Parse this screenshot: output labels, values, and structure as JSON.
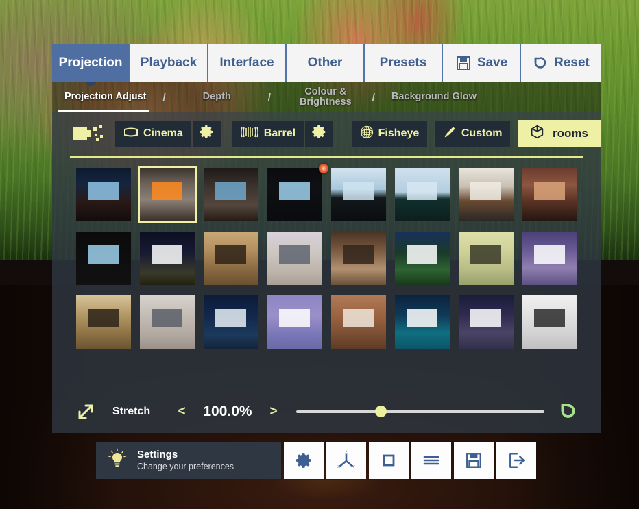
{
  "app": {
    "background_scene": "video playing - animated animals in grass field"
  },
  "tabs": [
    {
      "label": "Projection",
      "active": true,
      "icon": ""
    },
    {
      "label": "Playback",
      "active": false,
      "icon": ""
    },
    {
      "label": "Interface",
      "active": false,
      "icon": ""
    },
    {
      "label": "Other",
      "active": false,
      "icon": ""
    },
    {
      "label": "Presets",
      "active": false,
      "icon": ""
    },
    {
      "label": "Save",
      "active": false,
      "icon": "floppy-disk-icon"
    },
    {
      "label": "Reset",
      "active": false,
      "icon": "undo-arrow-icon"
    }
  ],
  "breadcrumb": {
    "separator": "/",
    "items": [
      {
        "label": "Projection Adjust",
        "active": true
      },
      {
        "label": "Depth",
        "active": false
      },
      {
        "label": "Colour &\nBrightness",
        "line1": "Colour &",
        "line2": "Brightness",
        "active": false
      },
      {
        "label": "Background Glow",
        "active": false
      }
    ]
  },
  "modebar": {
    "projector_icon": "projector-icon",
    "buttons": [
      {
        "label": "Cinema",
        "icon": "screen-icon",
        "selected": false,
        "has_gear": true
      },
      {
        "label": "Barrel",
        "icon": "barrel-icon",
        "selected": false,
        "has_gear": true
      },
      {
        "label": "Fisheye",
        "icon": "fisheye-icon",
        "selected": false,
        "has_gear": false
      },
      {
        "label": "Custom",
        "icon": "pencil-icon",
        "selected": false,
        "has_gear": false
      },
      {
        "label": "rooms",
        "icon": "cube-icon",
        "selected": true,
        "has_gear": false
      }
    ],
    "gear_icon": "gear-icon",
    "divider_color": "#e4e98a"
  },
  "thumbnails": {
    "selected_index": 1,
    "badge_index": 3,
    "items": [
      {
        "name": "drive-in-car-view",
        "css": "linear-gradient(180deg,#0d1a2e 0%,#152540 30%,#2a1a18 62%,#120c0c 100%)",
        "accent": "#8fc6e8"
      },
      {
        "name": "living-room-fireplace",
        "css": "linear-gradient(180deg,#3b352e 0%,#6b6057 28%,#8b8076 60%,#3a2f26 100%)",
        "accent": "#ff8a1e"
      },
      {
        "name": "dark-hallway-room",
        "css": "linear-gradient(180deg,#1e1a18 0%,#3c332e 35%,#54463c 70%,#241a15 100%)",
        "accent": "#6fa8cc"
      },
      {
        "name": "home-theatre-seats",
        "css": "linear-gradient(180deg,#0b0c10 0%,#0e1014 35%,#0a0b0e 100%)",
        "accent": "#9fd2ef"
      },
      {
        "name": "wide-screen-theatre",
        "css": "linear-gradient(180deg,#d3e4ef 0%,#a8c8dc 40%,#12181c 56%,#0a0d10 100%)",
        "accent": "#cfe4f1"
      },
      {
        "name": "open-air-screen",
        "css": "linear-gradient(180deg,#cfe1ee 0%,#b4cde0 45%,#11302e 58%,#0b1f1e 100%)",
        "accent": "#d6e7f2"
      },
      {
        "name": "modern-lounge-bright",
        "css": "linear-gradient(180deg,#e8e5de 0%,#c8c0b2 35%,#6a4a32 62%,#2a2724 100%)",
        "accent": "#f0ece4"
      },
      {
        "name": "modern-lounge-warm",
        "css": "linear-gradient(180deg,#6b3c2e 0%,#8d5640 32%,#5a3324 62%,#241612 100%)",
        "accent": "#d9a37a"
      },
      {
        "name": "framed-screen-blue-sky",
        "css": "linear-gradient(180deg,#0b0b0b 0%,#111 100%)",
        "accent": "#9ed2ef"
      },
      {
        "name": "night-outdoor-screen",
        "css": "linear-gradient(180deg,#0c0f22 0%,#171a33 40%,#3a3a2a 78%,#22200f 100%)",
        "accent": "#ffffff"
      },
      {
        "name": "classic-panorama-hall",
        "css": "linear-gradient(180deg,#c9a978 0%,#b28f5e 35%,#8a6a42 70%,#6a4f30 100%)",
        "accent": "#2e2218"
      },
      {
        "name": "white-gallery-pano",
        "css": "linear-gradient(180deg,#d8d2dc 0%,#cdc6c0 40%,#bdb4ab 75%,#a99f96 100%)",
        "accent": "#5f6570"
      },
      {
        "name": "brown-dome-theatre",
        "css": "linear-gradient(180deg,#4a3224 0%,#7a5a40 35%,#b09070 70%,#6b5038 100%)",
        "accent": "#32261c"
      },
      {
        "name": "backyard-night-screen",
        "css": "linear-gradient(180deg,#17305c 0%,#1b3a2a 40%,#2e6332 72%,#16381a 100%)",
        "accent": "#ffffff"
      },
      {
        "name": "green-room-panorama",
        "css": "linear-gradient(180deg,#dcdfa8 0%,#cfd39a 35%,#b9bd86 70%,#9aa06c 100%)",
        "accent": "#3a3a28"
      },
      {
        "name": "purple-dusk-poolside",
        "css": "linear-gradient(180deg,#4a3f77 0%,#6a5a96 35%,#8f7fb0 68%,#5c5182 100%)",
        "accent": "#ffffff"
      },
      {
        "name": "gold-lounge-pano",
        "css": "linear-gradient(180deg,#d6c49a 0%,#b59a68 35%,#8d7245 72%,#6b5531 100%)",
        "accent": "#2b2318"
      },
      {
        "name": "grey-arch-hall-pano",
        "css": "linear-gradient(180deg,#d7d2cc 0%,#c2bbb4 40%,#b3aaa2 72%,#9b918a 100%)",
        "accent": "#5a5f68"
      },
      {
        "name": "starry-night-room",
        "css": "linear-gradient(180deg,#0c1c3a 0%,#12284c 40%,#1b3a5c 75%,#14233a 100%)",
        "accent": "#e6eef6"
      },
      {
        "name": "palm-pool-dusk",
        "css": "linear-gradient(180deg,#8d86c2 0%,#9b8fc9 38%,#7a78b8 72%,#6a6aa8 100%)",
        "accent": "#ffffff"
      },
      {
        "name": "warm-cave-lounge",
        "css": "linear-gradient(180deg,#b07a56 0%,#9a6442 38%,#7c4f33 72%,#5e3b26 100%)",
        "accent": "#efe6dc"
      },
      {
        "name": "teal-pool-night",
        "css": "linear-gradient(180deg,#0b2440 0%,#0f3a58 38%,#0f6f80 70%,#0c5568 100%)",
        "accent": "#ffffff"
      },
      {
        "name": "beach-cabana-screen",
        "css": "linear-gradient(180deg,#1c1c3c 0%,#2e2a4e 35%,#4a4466 70%,#32304c 100%)",
        "accent": "#ffffff"
      },
      {
        "name": "white-modern-theatre",
        "css": "linear-gradient(180deg,#f0f0f0 0%,#e2e2e2 35%,#d2d2d2 72%,#c0c0c0 100%)",
        "accent": "#2b2b2b"
      }
    ]
  },
  "slider": {
    "icon": "stretch-arrows-icon",
    "label": "Stretch",
    "decrement": "<",
    "increment": ">",
    "value": "100.0%",
    "knob_percent": 34,
    "reset_icon": "reset-arrow-icon",
    "reset_color": "#a7e08a"
  },
  "bottombar": {
    "settings": {
      "icon": "lightbulb-icon",
      "title": "Settings",
      "subtitle": "Change your preferences"
    },
    "buttons": [
      {
        "name": "gear-icon",
        "label": "settings"
      },
      {
        "name": "axis-xyz-icon",
        "label": "orientation"
      },
      {
        "name": "square-icon",
        "label": "aspect"
      },
      {
        "name": "hamburger-icon",
        "label": "menu"
      },
      {
        "name": "floppy-disk-icon",
        "label": "save"
      },
      {
        "name": "exit-icon",
        "label": "exit"
      }
    ]
  },
  "colors": {
    "tab_active_bg": "#4f6fa3",
    "tab_text": "#41608f",
    "accent_yellow": "#eef0a6",
    "panel_bg": "rgba(47,56,66,0.80)",
    "mode_btn_bg": "#222c36"
  }
}
